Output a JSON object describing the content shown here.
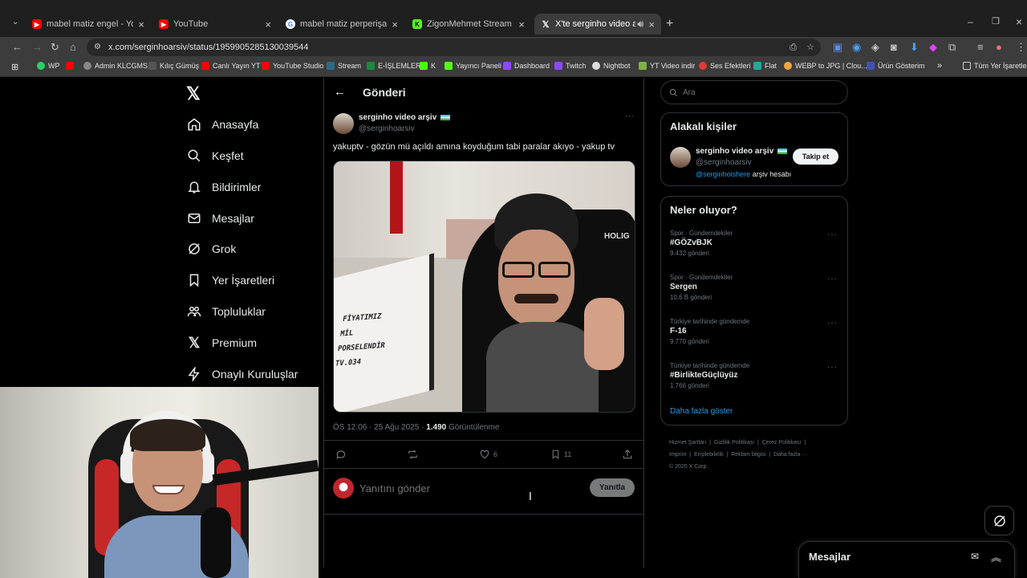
{
  "browser": {
    "tabs": [
      {
        "label": "mabel matiz engel - YouTube",
        "icon": "youtube-icon",
        "color": "#ff0000"
      },
      {
        "label": "YouTube",
        "icon": "youtube-icon",
        "color": "#ff0000"
      },
      {
        "label": "mabel matiz perperişan sözleri",
        "icon": "google-icon",
        "color": "#4285f4"
      },
      {
        "label": "ZigonMehmet Stream - Watch",
        "icon": "kick-icon",
        "color": "#53fc18"
      },
      {
        "label": "X'te serginho video arşiv adl",
        "icon": "x-icon",
        "color": "#ffffff"
      }
    ],
    "url": "x.com/serginhoarsiv/status/1959905285130039544",
    "bookmarks": [
      "WP",
      "",
      "Admin KLCGMS",
      "Kılıç Gümüş",
      "Canlı Yayın YT",
      "YouTube Studio",
      "Stream",
      "E-İŞLEMLER",
      "K",
      "Yayıncı Paneli",
      "Dashboard",
      "Twitch",
      "Nightbot",
      "YT Video indir",
      "Ses Efektleri",
      "Flat",
      "WEBP to JPG | Clou...",
      "Ürün Gösterim"
    ],
    "bookmarks_more": "»",
    "all_bookmarks": "Tüm Yer İşaretleri"
  },
  "nav": {
    "items": [
      {
        "label": "Anasayfa",
        "icon": "home-icon"
      },
      {
        "label": "Keşfet",
        "icon": "search-icon"
      },
      {
        "label": "Bildirimler",
        "icon": "bell-icon"
      },
      {
        "label": "Mesajlar",
        "icon": "mail-icon"
      },
      {
        "label": "Grok",
        "icon": "grok-icon"
      },
      {
        "label": "Yer İşaretleri",
        "icon": "bookmark-icon"
      },
      {
        "label": "Topluluklar",
        "icon": "communities-icon"
      },
      {
        "label": "Premium",
        "icon": "x-icon"
      },
      {
        "label": "Onaylı Kuruluşlar",
        "icon": "lightning-icon"
      }
    ]
  },
  "post": {
    "header_title": "Gönderi",
    "author_name": "serginho video arşiv",
    "author_handle": "@serginhoarsiv",
    "text": "yakuptv - gözün mü açıldı amına koyduğum tabi paralar akıyo - yakup tv",
    "video_text": {
      "line1": "FİYATIMIZ",
      "line2": "MİL",
      "line3": "PORSELENDİR",
      "line4": "TV.034",
      "logo": "HOLIG"
    },
    "meta_time": "ÖS 12:06 · 25 Ağu 2025 · ",
    "views": "1.490",
    "views_label": "Görüntülenme",
    "likes": "6",
    "bookmarks": "11",
    "reply_placeholder": "Yanıtını gönder",
    "reply_button": "Yanıtla"
  },
  "sidebar": {
    "search_placeholder": "Ara",
    "related_title": "Alakalı kişiler",
    "related_name": "serginho video arşiv",
    "related_handle": "@serginhoarsiv",
    "follow_button": "Takip et",
    "related_bio_link": "@serginhoishere",
    "related_bio_text": " arşiv hesabı",
    "trends_title": "Neler oluyor?",
    "trends": [
      {
        "category": "Spor · Gündemdekiler",
        "name": "#GÖZvBJK",
        "count": "9.432 gönderi"
      },
      {
        "category": "Spor · Gündemdekiler",
        "name": "Sergen",
        "count": "10,6 B gönderi"
      },
      {
        "category": "Türkiye tarihinde gündemde",
        "name": "F-16",
        "count": "9.770 gönderi"
      },
      {
        "category": "Türkiye tarihinde gündemde",
        "name": "#BirlikteGüçlüyüz",
        "count": "1.766 gönderi"
      }
    ],
    "show_more": "Daha fazla göster",
    "footer": [
      "Hizmet Şartları",
      "Gizlilik Politikası",
      "Çerez Politikası",
      "Imprint",
      "Erişilebilirlik",
      "Reklam bilgisi",
      "Daha fazla ···",
      "© 2025 X Corp."
    ]
  },
  "messages_bar": {
    "label": "Mesajlar"
  },
  "colors": {
    "accent": "#1d9bf0",
    "bg": "#000000",
    "border": "#2f3336",
    "muted": "#71767b"
  }
}
